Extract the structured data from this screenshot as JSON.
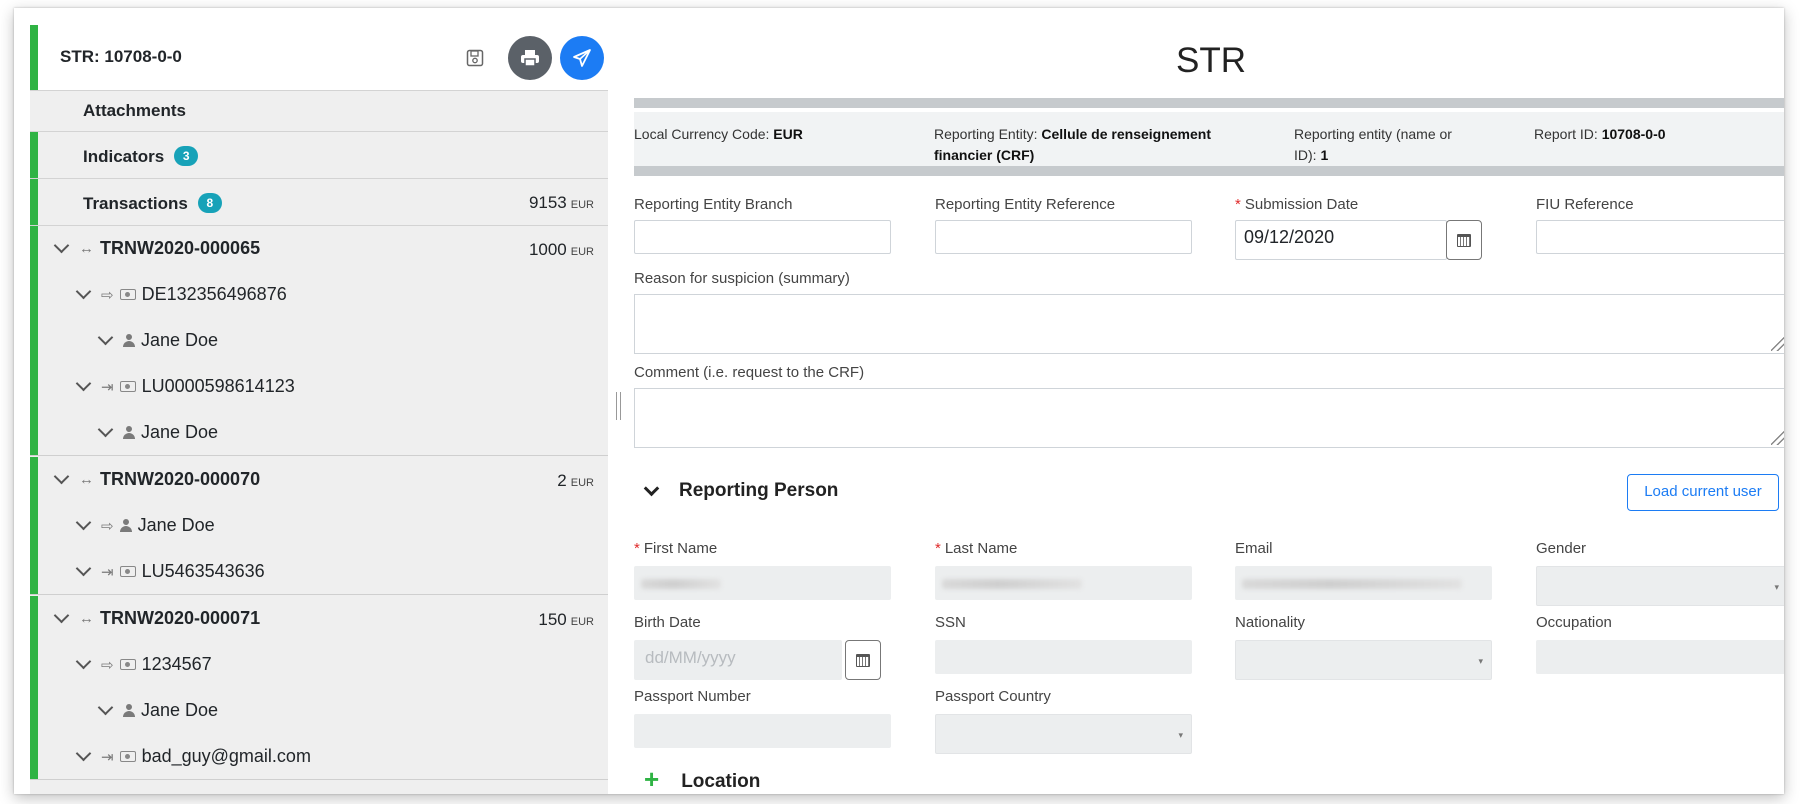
{
  "tree": {
    "title": "STR: 10708-0-0",
    "attachments_label": "Attachments",
    "indicators_label": "Indicators",
    "indicators_count": "3",
    "transactions_label": "Transactions",
    "transactions_count": "8",
    "transactions_total": "9153",
    "currency": "EUR",
    "transactions": [
      {
        "code": "TRNW2020-000065",
        "amount": "1000",
        "from": "DE132356496876",
        "from_person": "Jane Doe",
        "to": "LU0000598614123",
        "to_person": "Jane Doe"
      },
      {
        "code": "TRNW2020-000070",
        "amount": "2",
        "from_person": "Jane Doe",
        "to": "LU5463543636"
      },
      {
        "code": "TRNW2020-000071",
        "amount": "150",
        "from": "1234567",
        "from_person": "Jane Doe",
        "to": "bad_guy@gmail.com"
      }
    ]
  },
  "icons": {
    "save": "floppy-disk-icon",
    "print": "printer-icon",
    "send": "paper-plane-icon",
    "transaction": "double-arrow-icon",
    "outgoing": "sign-out-icon",
    "incoming": "sign-in-icon",
    "account": "money-bill-icon",
    "person": "user-icon",
    "calendar": "calendar-icon"
  },
  "colors": {
    "accent_green": "#2fb344",
    "primary_blue": "#1c7cf4",
    "badge_teal": "#17a2b8"
  },
  "form": {
    "title": "STR",
    "info": {
      "local_currency_label": "Local Currency Code:",
      "local_currency_value": "EUR",
      "reporting_entity_label": "Reporting Entity:",
      "reporting_entity_value_line1": "Cellule de renseignement",
      "reporting_entity_value_line2": "financier (CRF)",
      "entity_name_label_line1": "Reporting entity (name or",
      "entity_name_label_line2": "ID):",
      "entity_name_value": "1",
      "report_id_label": "Report ID:",
      "report_id_value": "10708-0-0"
    },
    "fields": {
      "branch_label": "Reporting Entity Branch",
      "reference_label": "Reporting Entity Reference",
      "submission_date_label": "Submission Date",
      "submission_date_value": "09/12/2020",
      "fiu_reference_label": "FIU Reference",
      "reason_label": "Reason for suspicion (summary)",
      "comment_label": "Comment (i.e. request to the CRF)"
    },
    "reporting_person": {
      "heading": "Reporting Person",
      "load_user_button": "Load current user",
      "first_name_label": "First Name",
      "last_name_label": "Last Name",
      "email_label": "Email",
      "gender_label": "Gender",
      "birth_date_label": "Birth Date",
      "birth_date_placeholder": "dd/MM/yyyy",
      "ssn_label": "SSN",
      "nationality_label": "Nationality",
      "occupation_label": "Occupation",
      "passport_number_label": "Passport Number",
      "passport_country_label": "Passport Country"
    },
    "location_heading": "Location"
  }
}
